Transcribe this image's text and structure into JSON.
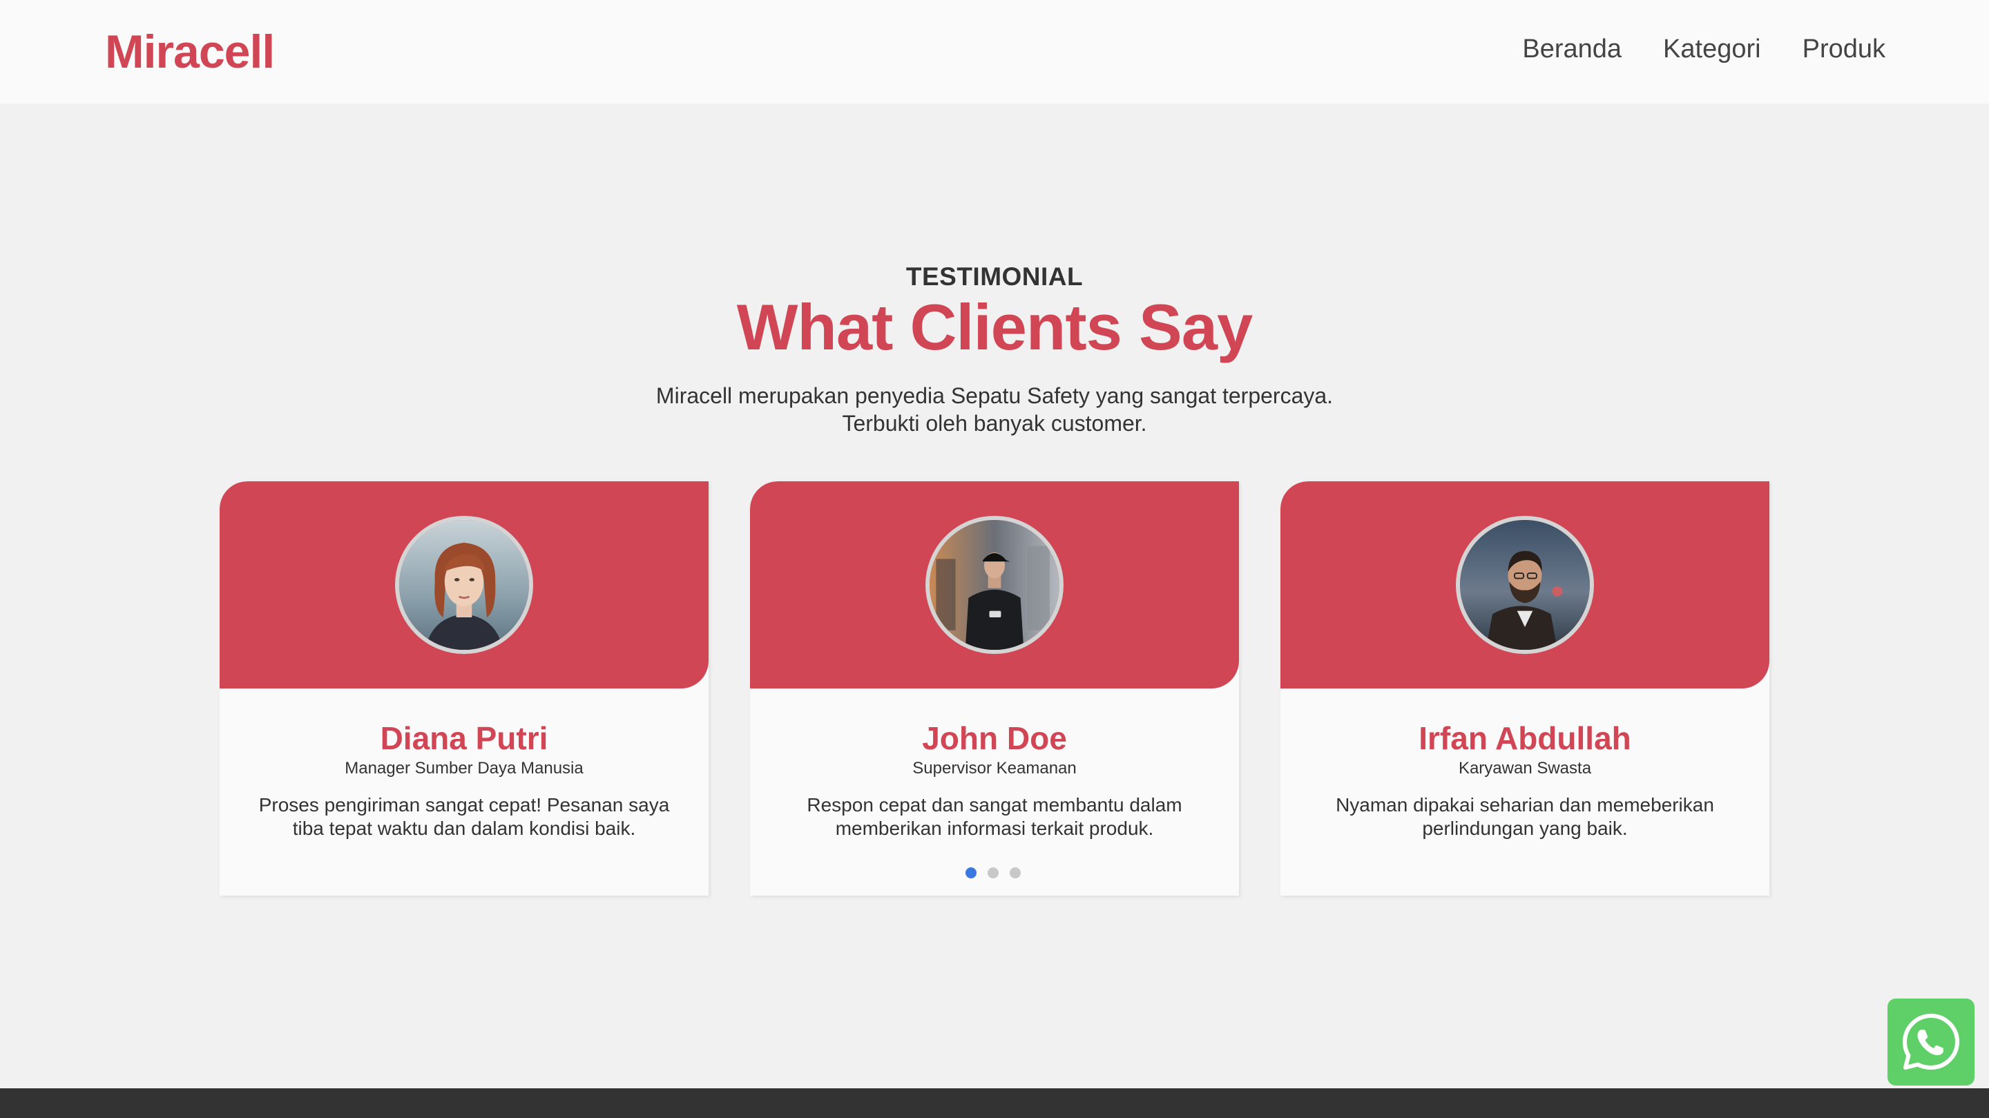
{
  "brand": {
    "name": "Miracell",
    "accent": "#d14654"
  },
  "nav": {
    "items": [
      {
        "label": "Beranda"
      },
      {
        "label": "Kategori"
      },
      {
        "label": "Produk"
      }
    ]
  },
  "testimonial": {
    "eyebrow": "TESTIMONIAL",
    "title": "What Clients Say",
    "subtitle_line1": "Miracell merupakan penyedia Sepatu Safety yang sangat terpercaya.",
    "subtitle_line2": "Terbukti oleh banyak customer.",
    "cards": [
      {
        "name": "Diana Putri",
        "role": "Manager Sumber Daya Manusia",
        "quote": "Proses pengiriman sangat cepat! Pesanan saya tiba tepat waktu dan dalam kondisi baik."
      },
      {
        "name": "John Doe",
        "role": "Supervisor Keamanan",
        "quote": "Respon cepat dan sangat membantu dalam memberikan informasi terkait produk."
      },
      {
        "name": "Irfan Abdullah",
        "role": "Karyawan Swasta",
        "quote": "Nyaman dipakai seharian dan memeberikan perlindungan yang baik."
      }
    ],
    "carousel": {
      "total_pages": 3,
      "active_page": 1
    }
  },
  "whatsapp": {
    "icon": "whatsapp-icon",
    "color": "#5fd068"
  }
}
